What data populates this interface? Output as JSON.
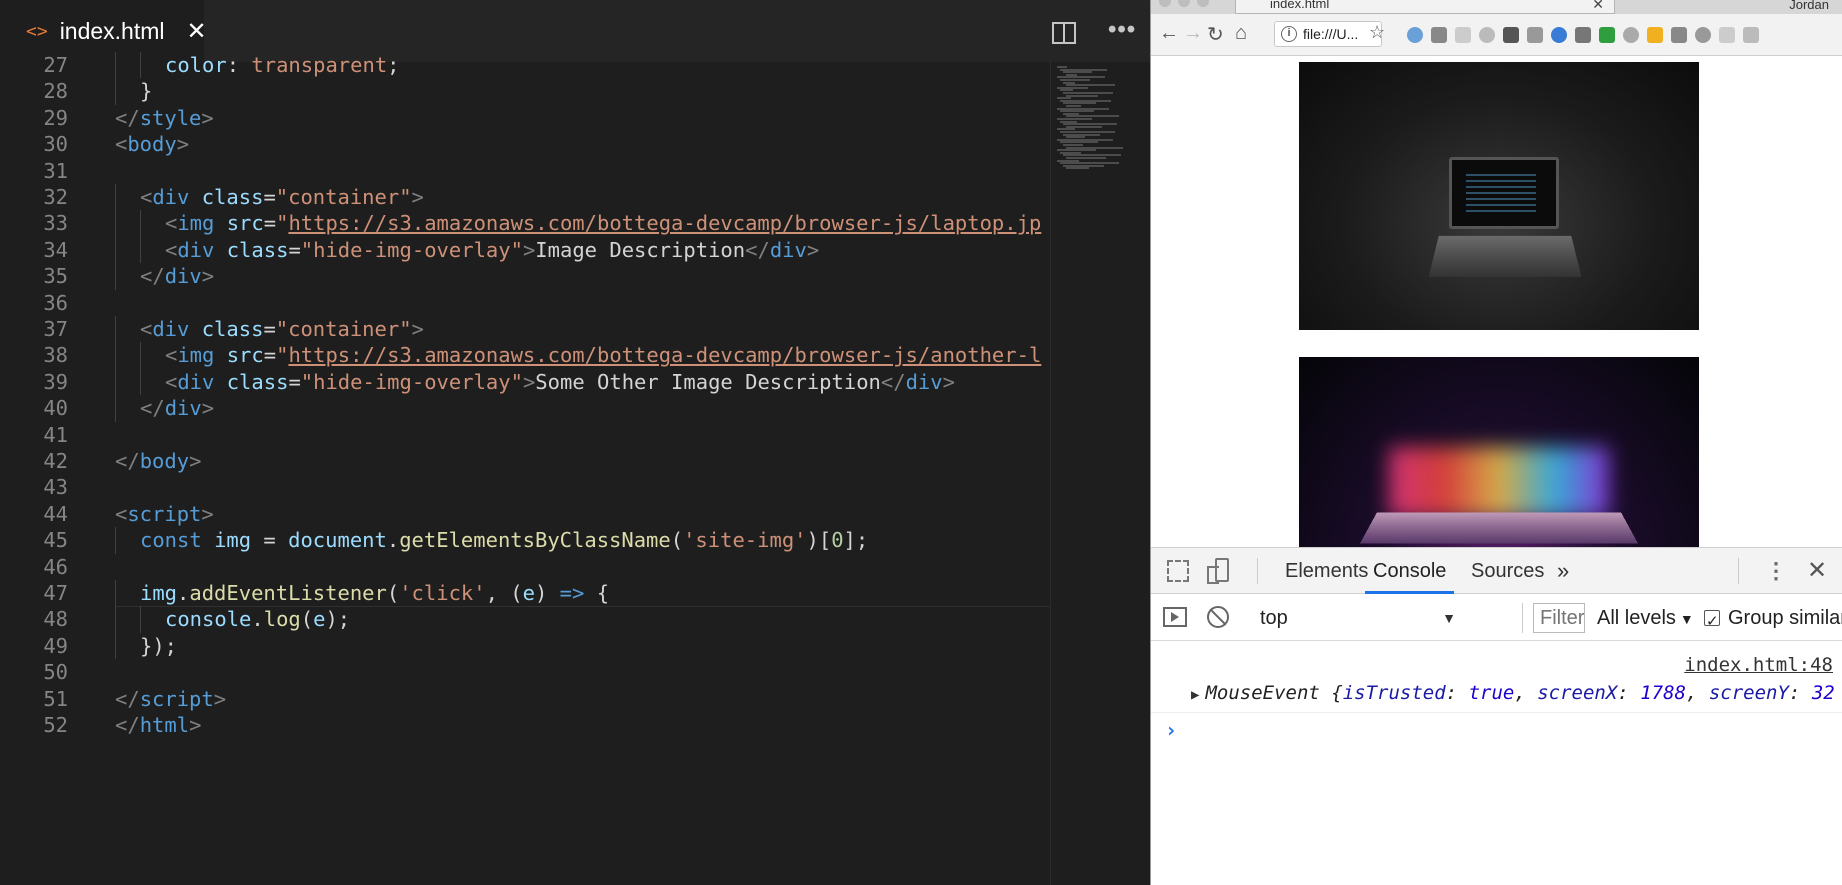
{
  "editor": {
    "tab": {
      "title": "index.html",
      "close": "✕",
      "icon": "code-icon"
    },
    "toolbar": {
      "split_icon": "split-editor-icon",
      "more": "•••"
    },
    "lines": [
      {
        "n": "27",
        "indent": 2,
        "segs": [
          [
            "att",
            "color"
          ],
          [
            "w",
            ": "
          ],
          [
            "str",
            "transparent"
          ],
          [
            "w",
            ";"
          ]
        ]
      },
      {
        "n": "28",
        "indent": 1,
        "segs": [
          [
            "w",
            "}"
          ]
        ]
      },
      {
        "n": "29",
        "indent": 0,
        "segs": [
          [
            "p",
            "</"
          ],
          [
            "tag",
            "style"
          ],
          [
            "p",
            ">"
          ]
        ]
      },
      {
        "n": "30",
        "indent": 0,
        "segs": [
          [
            "p",
            "<"
          ],
          [
            "tag",
            "body"
          ],
          [
            "p",
            ">"
          ]
        ]
      },
      {
        "n": "31",
        "indent": 0,
        "segs": []
      },
      {
        "n": "32",
        "indent": 1,
        "segs": [
          [
            "p",
            "<"
          ],
          [
            "tag",
            "div"
          ],
          [
            "w",
            " "
          ],
          [
            "att",
            "class"
          ],
          [
            "w",
            "="
          ],
          [
            "str",
            "\"container\""
          ],
          [
            "p",
            ">"
          ]
        ]
      },
      {
        "n": "33",
        "indent": 2,
        "segs": [
          [
            "p",
            "<"
          ],
          [
            "tag",
            "img"
          ],
          [
            "w",
            " "
          ],
          [
            "att",
            "src"
          ],
          [
            "w",
            "="
          ],
          [
            "str",
            "\""
          ],
          [
            "url",
            "https://s3.amazonaws.com/bottega-devcamp/browser-js/laptop.jp"
          ]
        ]
      },
      {
        "n": "34",
        "indent": 2,
        "segs": [
          [
            "p",
            "<"
          ],
          [
            "tag",
            "div"
          ],
          [
            "w",
            " "
          ],
          [
            "att",
            "class"
          ],
          [
            "w",
            "="
          ],
          [
            "str",
            "\"hide-img-overlay\""
          ],
          [
            "p",
            ">"
          ],
          [
            "w",
            "Image Description"
          ],
          [
            "p",
            "</"
          ],
          [
            "tag",
            "div"
          ],
          [
            "p",
            ">"
          ]
        ]
      },
      {
        "n": "35",
        "indent": 1,
        "segs": [
          [
            "p",
            "</"
          ],
          [
            "tag",
            "div"
          ],
          [
            "p",
            ">"
          ]
        ]
      },
      {
        "n": "36",
        "indent": 0,
        "segs": []
      },
      {
        "n": "37",
        "indent": 1,
        "segs": [
          [
            "p",
            "<"
          ],
          [
            "tag",
            "div"
          ],
          [
            "w",
            " "
          ],
          [
            "att",
            "class"
          ],
          [
            "w",
            "="
          ],
          [
            "str",
            "\"container\""
          ],
          [
            "p",
            ">"
          ]
        ]
      },
      {
        "n": "38",
        "indent": 2,
        "segs": [
          [
            "p",
            "<"
          ],
          [
            "tag",
            "img"
          ],
          [
            "w",
            " "
          ],
          [
            "att",
            "src"
          ],
          [
            "w",
            "="
          ],
          [
            "str",
            "\""
          ],
          [
            "url",
            "https://s3.amazonaws.com/bottega-devcamp/browser-js/another-l"
          ]
        ]
      },
      {
        "n": "39",
        "indent": 2,
        "segs": [
          [
            "p",
            "<"
          ],
          [
            "tag",
            "div"
          ],
          [
            "w",
            " "
          ],
          [
            "att",
            "class"
          ],
          [
            "w",
            "="
          ],
          [
            "str",
            "\"hide-img-overlay\""
          ],
          [
            "p",
            ">"
          ],
          [
            "w",
            "Some Other Image Description"
          ],
          [
            "p",
            "</"
          ],
          [
            "tag",
            "div"
          ],
          [
            "p",
            ">"
          ]
        ]
      },
      {
        "n": "40",
        "indent": 1,
        "segs": [
          [
            "p",
            "</"
          ],
          [
            "tag",
            "div"
          ],
          [
            "p",
            ">"
          ]
        ]
      },
      {
        "n": "41",
        "indent": 0,
        "segs": []
      },
      {
        "n": "42",
        "indent": 0,
        "segs": [
          [
            "p",
            "</"
          ],
          [
            "tag",
            "body"
          ],
          [
            "p",
            ">"
          ]
        ]
      },
      {
        "n": "43",
        "indent": 0,
        "segs": []
      },
      {
        "n": "44",
        "indent": 0,
        "segs": [
          [
            "p",
            "<"
          ],
          [
            "tag",
            "script"
          ],
          [
            "p",
            ">"
          ]
        ]
      },
      {
        "n": "45",
        "indent": 1,
        "segs": [
          [
            "kw",
            "const"
          ],
          [
            "w",
            " "
          ],
          [
            "var",
            "img"
          ],
          [
            "w",
            " = "
          ],
          [
            "var",
            "document"
          ],
          [
            "w",
            "."
          ],
          [
            "fn",
            "getElementsByClassName"
          ],
          [
            "w",
            "("
          ],
          [
            "str",
            "'site-img'"
          ],
          [
            "w",
            ")["
          ],
          [
            "num",
            "0"
          ],
          [
            "w",
            "];"
          ]
        ]
      },
      {
        "n": "46",
        "indent": 0,
        "segs": []
      },
      {
        "n": "47",
        "indent": 1,
        "segs": [
          [
            "var",
            "img"
          ],
          [
            "w",
            "."
          ],
          [
            "fn",
            "addEventListener"
          ],
          [
            "w",
            "("
          ],
          [
            "str",
            "'click'"
          ],
          [
            "w",
            ", ("
          ],
          [
            "var",
            "e"
          ],
          [
            "w",
            ") "
          ],
          [
            "kw",
            "=>"
          ],
          [
            "w",
            " {"
          ]
        ]
      },
      {
        "n": "48",
        "indent": 2,
        "segs": [
          [
            "var",
            "console"
          ],
          [
            "w",
            "."
          ],
          [
            "fn",
            "log"
          ],
          [
            "w",
            "("
          ],
          [
            "var",
            "e"
          ],
          [
            "w",
            ");"
          ]
        ],
        "current": true
      },
      {
        "n": "49",
        "indent": 1,
        "segs": [
          [
            "w",
            "});"
          ]
        ]
      },
      {
        "n": "50",
        "indent": 0,
        "segs": []
      },
      {
        "n": "51",
        "indent": 0,
        "segs": [
          [
            "p",
            "</"
          ],
          [
            "tag",
            "script"
          ],
          [
            "p",
            ">"
          ]
        ]
      },
      {
        "n": "52",
        "indent": 0,
        "segs": [
          [
            "p",
            "</"
          ],
          [
            "tag",
            "html"
          ],
          [
            "p",
            ">"
          ]
        ]
      }
    ]
  },
  "browser": {
    "tab_title": "index.html",
    "tab_close": "✕",
    "profile": "Jordan",
    "nav": {
      "back": "←",
      "forward": "→",
      "reload": "↻",
      "home": "⌂"
    },
    "address": "file:///U...",
    "star": "☆",
    "extensions": [
      "#6aa0d8",
      "#888888",
      "#cccccc",
      "#bbbbbb",
      "#555555",
      "#999999",
      "#3a7bd5",
      "#777777",
      "#2e9e3e",
      "#aaaaaa",
      "#f0b020",
      "#888888",
      "#999999",
      "#cccccc",
      "#bbbbbb"
    ],
    "images": [
      {
        "name": "laptop-photo"
      },
      {
        "name": "another-laptop-photo"
      }
    ]
  },
  "devtools": {
    "tabs": {
      "elements": "Elements",
      "console": "Console",
      "sources": "Sources",
      "more": "»"
    },
    "kebab": "⋮",
    "close": "✕",
    "context": "top",
    "filter_placeholder": "Filter",
    "levels": "All levels",
    "group_similar": "Group similar",
    "source_link": "index.html:48",
    "log": {
      "class_name": "MouseEvent",
      "k1": "isTrusted",
      "v1": "true",
      "k2": "screenX",
      "v2": "1788",
      "k3": "screenY",
      "v3": "32"
    },
    "prompt": "›"
  }
}
